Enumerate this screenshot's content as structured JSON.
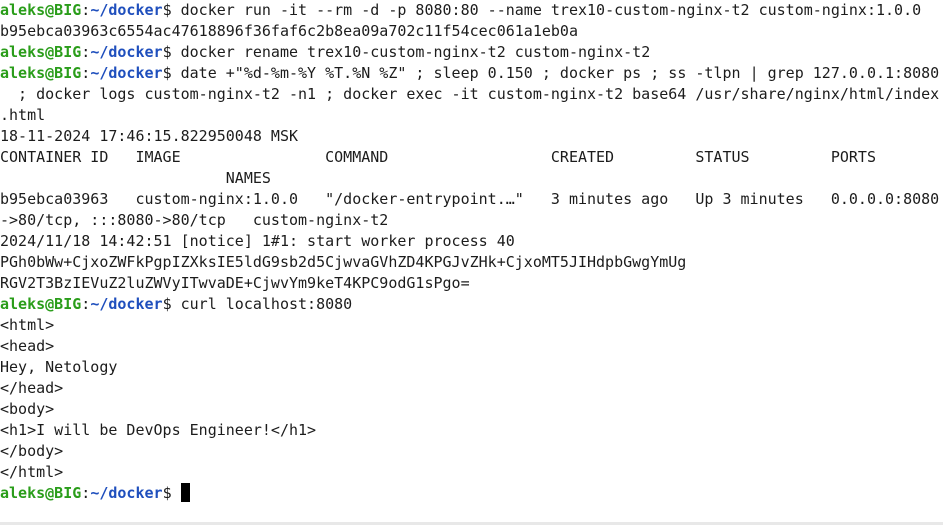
{
  "prompt": {
    "user_host": "aleks@BIG",
    "separator": ":",
    "path": "~/docker",
    "symbol": "$ "
  },
  "lines": [
    {
      "type": "prompt",
      "text": "docker run -it --rm -d -p 8080:80 --name trex10-custom-nginx-t2 custom-nginx:1.0.0"
    },
    {
      "type": "output",
      "text": "b95ebca03963c6554ac47618896f36faf6c2b8ea09a702c11f54cec061a1eb0a"
    },
    {
      "type": "prompt",
      "text": "docker rename trex10-custom-nginx-t2 custom-nginx-t2"
    },
    {
      "type": "prompt",
      "text": "date +\"%d-%m-%Y %T.%N %Z\" ; sleep 0.150 ; docker ps ; ss -tlpn | grep 127.0.0.1:8080"
    },
    {
      "type": "output",
      "text": "  ; docker logs custom-nginx-t2 -n1 ; docker exec -it custom-nginx-t2 base64 /usr/share/nginx/html/index"
    },
    {
      "type": "output",
      "text": ".html"
    },
    {
      "type": "output",
      "text": "18-11-2024 17:46:15.822950048 MSK"
    },
    {
      "type": "output",
      "text": "CONTAINER ID   IMAGE                COMMAND                  CREATED         STATUS         PORTS"
    },
    {
      "type": "output",
      "text": "                         NAMES"
    },
    {
      "type": "output",
      "text": "b95ebca03963   custom-nginx:1.0.0   \"/docker-entrypoint.…\"   3 minutes ago   Up 3 minutes   0.0.0.0:8080"
    },
    {
      "type": "output",
      "text": "->80/tcp, :::8080->80/tcp   custom-nginx-t2"
    },
    {
      "type": "output",
      "text": "2024/11/18 14:42:51 [notice] 1#1: start worker process 40"
    },
    {
      "type": "output",
      "text": "PGh0bWw+CjxoZWFkPgpIZXksIE5ldG9sb2d5CjwvaGVhZD4KPGJvZHk+CjxoMT5JIHdpbGwgYmUg"
    },
    {
      "type": "output",
      "text": "RGV2T3BzIEVuZ2luZWVyITwvaDE+CjwvYm9keT4KPC9odG1sPgo="
    },
    {
      "type": "prompt",
      "text": "curl localhost:8080"
    },
    {
      "type": "output",
      "text": "<html>"
    },
    {
      "type": "output",
      "text": "<head>"
    },
    {
      "type": "output",
      "text": "Hey, Netology"
    },
    {
      "type": "output",
      "text": "</head>"
    },
    {
      "type": "output",
      "text": "<body>"
    },
    {
      "type": "output",
      "text": "<h1>I will be DevOps Engineer!</h1>"
    },
    {
      "type": "output",
      "text": "</body>"
    },
    {
      "type": "output",
      "text": "</html>"
    },
    {
      "type": "prompt",
      "text": "",
      "cursor": true
    }
  ]
}
